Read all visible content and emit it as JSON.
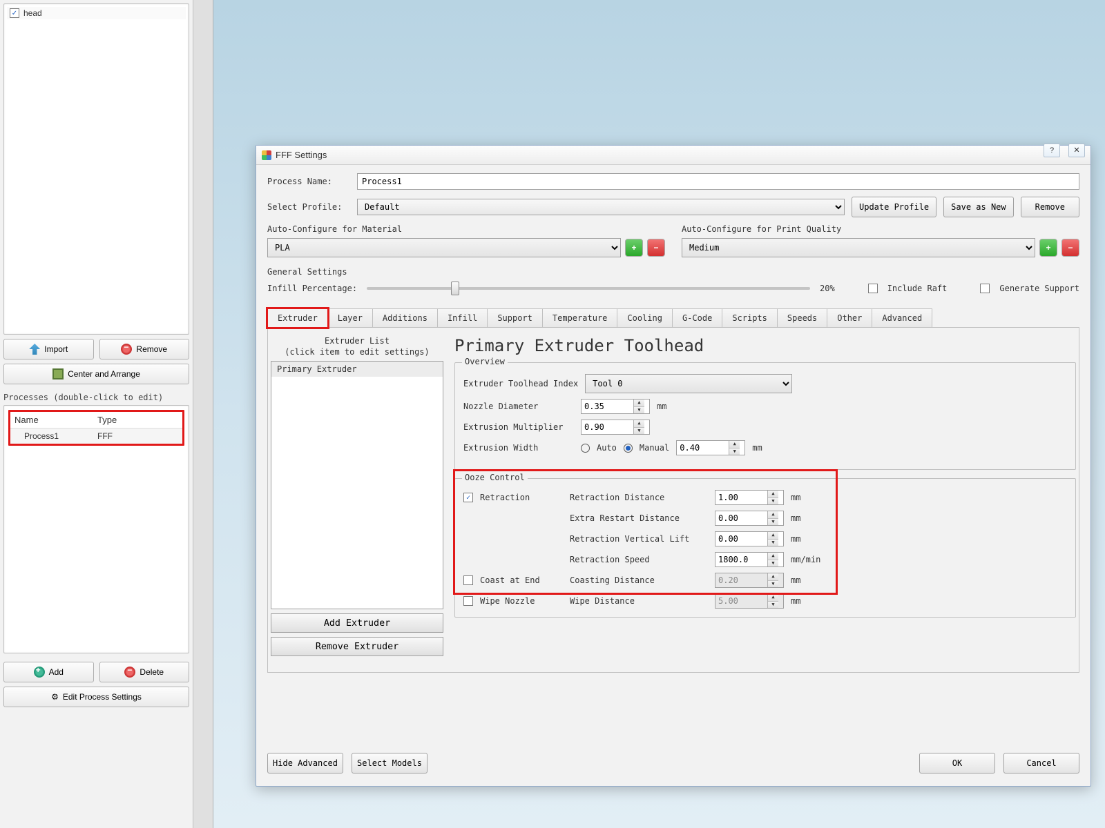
{
  "models": {
    "items": [
      {
        "checked": true,
        "label": "head"
      }
    ]
  },
  "buttons": {
    "import": "Import",
    "remove": "Remove",
    "center_arrange": "Center and Arrange",
    "add": "Add",
    "delete": "Delete",
    "edit_process": "Edit Process Settings"
  },
  "processes": {
    "label": "Processes (double-click to edit)",
    "headers": {
      "name": "Name",
      "type": "Type"
    },
    "rows": [
      {
        "name": "Process1",
        "type": "FFF"
      }
    ]
  },
  "dialog": {
    "title": "FFF Settings",
    "process_name_label": "Process Name:",
    "process_name": "Process1",
    "select_profile_label": "Select Profile:",
    "select_profile": "Default",
    "update_profile": "Update Profile",
    "save_as_new": "Save as New",
    "remove": "Remove",
    "auto_material_label": "Auto-Configure for Material",
    "material": "PLA",
    "auto_quality_label": "Auto-Configure for Print Quality",
    "quality": "Medium",
    "general_label": "General Settings",
    "infill_pct_label": "Infill Percentage:",
    "infill_pct_value": "20%",
    "include_raft": "Include Raft",
    "generate_support": "Generate Support",
    "tabs": [
      "Extruder",
      "Layer",
      "Additions",
      "Infill",
      "Support",
      "Temperature",
      "Cooling",
      "G-Code",
      "Scripts",
      "Speeds",
      "Other",
      "Advanced"
    ],
    "extruder_list_title": "Extruder List",
    "extruder_list_sub": "(click item to edit settings)",
    "extruder_list": [
      "Primary Extruder"
    ],
    "add_extruder": "Add Extruder",
    "remove_extruder": "Remove Extruder",
    "panel_title": "Primary Extruder Toolhead",
    "overview": {
      "legend": "Overview",
      "toolhead_idx_label": "Extruder Toolhead Index",
      "toolhead_idx": "Tool 0",
      "nozzle_label": "Nozzle Diameter",
      "nozzle": "0.35",
      "nozzle_unit": "mm",
      "multiplier_label": "Extrusion Multiplier",
      "multiplier": "0.90",
      "width_label": "Extrusion Width",
      "width_auto": "Auto",
      "width_manual": "Manual",
      "width_val": "0.40",
      "width_unit": "mm"
    },
    "ooze": {
      "legend": "Ooze Control",
      "retraction_label": "Retraction",
      "dist_label": "Retraction Distance",
      "dist": "1.00",
      "dist_unit": "mm",
      "extra_label": "Extra Restart Distance",
      "extra": "0.00",
      "extra_unit": "mm",
      "lift_label": "Retraction Vertical Lift",
      "lift": "0.00",
      "lift_unit": "mm",
      "speed_label": "Retraction Speed",
      "speed": "1800.0",
      "speed_unit": "mm/min",
      "coast_label": "Coast at End",
      "coast_dist_label": "Coasting Distance",
      "coast_dist": "0.20",
      "coast_unit": "mm",
      "wipe_label": "Wipe Nozzle",
      "wipe_dist_label": "Wipe Distance",
      "wipe_dist": "5.00",
      "wipe_unit": "mm"
    },
    "hide_advanced": "Hide Advanced",
    "select_models": "Select Models",
    "ok": "OK",
    "cancel": "Cancel"
  }
}
